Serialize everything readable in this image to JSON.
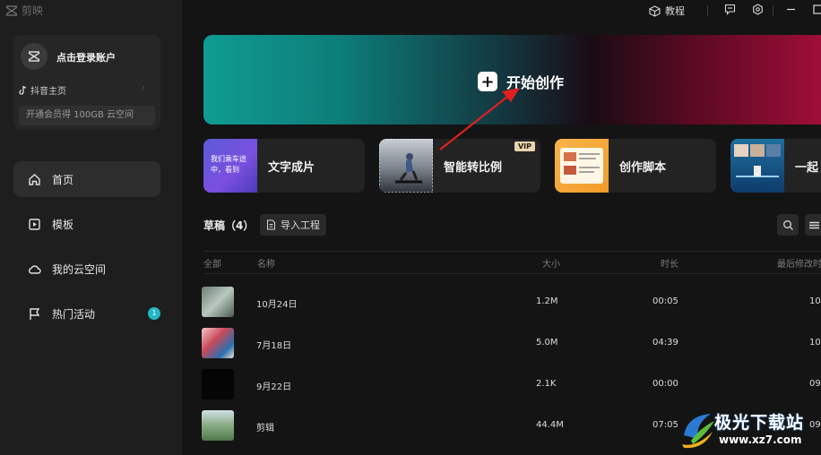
{
  "app": {
    "title": "剪映"
  },
  "topbar": {
    "tutorial_label": "教程"
  },
  "account": {
    "login_label": "点击登录账户",
    "douyin_label": "抖音主页",
    "member_label": "开通会员得 100GB 云空间"
  },
  "sidebar": {
    "items": [
      {
        "label": "首页"
      },
      {
        "label": "模板"
      },
      {
        "label": "我的云空间"
      },
      {
        "label": "热门活动",
        "badge": "1"
      }
    ]
  },
  "hero": {
    "label": "开始创作"
  },
  "tools": [
    {
      "label": "文字成片",
      "thumb_text": "我们乘车途中，看到"
    },
    {
      "label": "智能转比例",
      "badge": "VIP"
    },
    {
      "label": "创作脚本"
    },
    {
      "label": "一起"
    }
  ],
  "drafts": {
    "title": "草稿（4）",
    "import_label": "导入工程",
    "columns": {
      "all": "全部",
      "name": "名称",
      "size": "大小",
      "duration": "时长",
      "modified": "最后修改时"
    },
    "rows": [
      {
        "name": "10月24日",
        "size": "1.2M",
        "duration": "00:05",
        "modified": "10"
      },
      {
        "name": "7月18日",
        "size": "5.0M",
        "duration": "04:39",
        "modified": "10"
      },
      {
        "name": "9月22日",
        "size": "2.1K",
        "duration": "00:00",
        "modified": "09"
      },
      {
        "name": "剪辑",
        "size": "44.4M",
        "duration": "07:05",
        "modified": "09"
      }
    ]
  },
  "watermark": {
    "text": "极光下载站",
    "url": "www.xz7.com"
  },
  "colors": {
    "badge": "#20b6c8",
    "arrow": "#e02020",
    "vip": "#e9d3b0"
  }
}
